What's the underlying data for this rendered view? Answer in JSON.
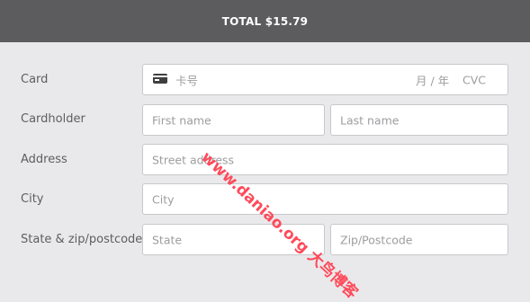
{
  "header": {
    "total_text": "TOTAL $15.79"
  },
  "form": {
    "card": {
      "label": "Card",
      "number_placeholder": "卡号",
      "expiry_placeholder": "月 / 年",
      "cvc_placeholder": "CVC",
      "icon": "credit-card-icon"
    },
    "cardholder": {
      "label": "Cardholder",
      "first_placeholder": "First name",
      "last_placeholder": "Last name"
    },
    "address": {
      "label": "Address",
      "placeholder": "Street address"
    },
    "city": {
      "label": "City",
      "placeholder": "City"
    },
    "state_zip": {
      "label": "State & zip/postcode",
      "state_placeholder": "State",
      "zip_placeholder": "Zip/Postcode"
    }
  },
  "watermark": {
    "text": "www.daniao.org 大鸟博客"
  },
  "colors": {
    "header_bg": "#5c5c5e",
    "page_bg": "#e9e9eb",
    "watermark": "#ff4a5a"
  }
}
